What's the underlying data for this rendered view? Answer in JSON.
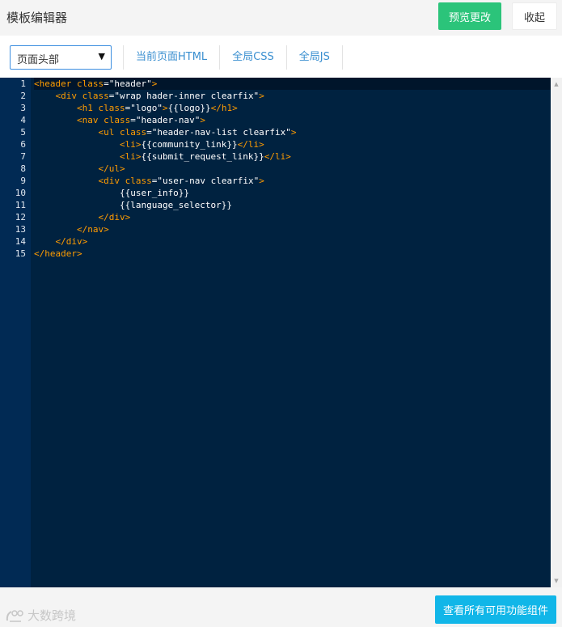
{
  "header": {
    "title": "模板编辑器",
    "preview_label": "预览更改",
    "collapse_label": "收起"
  },
  "toolbar": {
    "select_value": "页面头部",
    "tabs": [
      {
        "label": "当前页面HTML"
      },
      {
        "label": "全局CSS"
      },
      {
        "label": "全局JS"
      }
    ]
  },
  "editor": {
    "line_numbers": [
      "1",
      "2",
      "3",
      "4",
      "5",
      "6",
      "7",
      "8",
      "9",
      "10",
      "11",
      "12",
      "13",
      "14",
      "15"
    ],
    "lines": [
      [
        {
          "t": "tag",
          "v": "<header"
        },
        {
          "t": "text",
          "v": " "
        },
        {
          "t": "attr",
          "v": "class"
        },
        {
          "t": "text",
          "v": "="
        },
        {
          "t": "str",
          "v": "\"header\""
        },
        {
          "t": "tag",
          "v": ">"
        }
      ],
      [
        {
          "t": "text",
          "v": "    "
        },
        {
          "t": "tag",
          "v": "<div"
        },
        {
          "t": "text",
          "v": " "
        },
        {
          "t": "attr",
          "v": "class"
        },
        {
          "t": "text",
          "v": "="
        },
        {
          "t": "str",
          "v": "\"wrap hader-inner clearfix\""
        },
        {
          "t": "tag",
          "v": ">"
        }
      ],
      [
        {
          "t": "text",
          "v": "        "
        },
        {
          "t": "tag",
          "v": "<h1"
        },
        {
          "t": "text",
          "v": " "
        },
        {
          "t": "attr",
          "v": "class"
        },
        {
          "t": "text",
          "v": "="
        },
        {
          "t": "str",
          "v": "\"logo\""
        },
        {
          "t": "tag",
          "v": ">"
        },
        {
          "t": "text",
          "v": "{{logo}}"
        },
        {
          "t": "tag",
          "v": "</h1>"
        }
      ],
      [
        {
          "t": "text",
          "v": "        "
        },
        {
          "t": "tag",
          "v": "<nav"
        },
        {
          "t": "text",
          "v": " "
        },
        {
          "t": "attr",
          "v": "class"
        },
        {
          "t": "text",
          "v": "="
        },
        {
          "t": "str",
          "v": "\"header-nav\""
        },
        {
          "t": "tag",
          "v": ">"
        }
      ],
      [
        {
          "t": "text",
          "v": "            "
        },
        {
          "t": "tag",
          "v": "<ul"
        },
        {
          "t": "text",
          "v": " "
        },
        {
          "t": "attr",
          "v": "class"
        },
        {
          "t": "text",
          "v": "="
        },
        {
          "t": "str",
          "v": "\"header-nav-list clearfix\""
        },
        {
          "t": "tag",
          "v": ">"
        }
      ],
      [
        {
          "t": "text",
          "v": "                "
        },
        {
          "t": "tag",
          "v": "<li>"
        },
        {
          "t": "text",
          "v": "{{community_link}}"
        },
        {
          "t": "tag",
          "v": "</li>"
        }
      ],
      [
        {
          "t": "text",
          "v": "                "
        },
        {
          "t": "tag",
          "v": "<li>"
        },
        {
          "t": "text",
          "v": "{{submit_request_link}}"
        },
        {
          "t": "tag",
          "v": "</li>"
        }
      ],
      [
        {
          "t": "text",
          "v": "            "
        },
        {
          "t": "tag",
          "v": "</ul>"
        }
      ],
      [
        {
          "t": "text",
          "v": "            "
        },
        {
          "t": "tag",
          "v": "<div"
        },
        {
          "t": "text",
          "v": " "
        },
        {
          "t": "attr",
          "v": "class"
        },
        {
          "t": "text",
          "v": "="
        },
        {
          "t": "str",
          "v": "\"user-nav clearfix\""
        },
        {
          "t": "tag",
          "v": ">"
        }
      ],
      [
        {
          "t": "text",
          "v": "                {{user_info}}"
        }
      ],
      [
        {
          "t": "text",
          "v": "                {{language_selector}}"
        }
      ],
      [
        {
          "t": "text",
          "v": "            "
        },
        {
          "t": "tag",
          "v": "</div>"
        }
      ],
      [
        {
          "t": "text",
          "v": "        "
        },
        {
          "t": "tag",
          "v": "</nav>"
        }
      ],
      [
        {
          "t": "text",
          "v": "    "
        },
        {
          "t": "tag",
          "v": "</div>"
        }
      ],
      [
        {
          "t": "tag",
          "v": "</header>"
        }
      ]
    ]
  },
  "footer": {
    "widgets_label": "查看所有可用功能组件",
    "watermark_text": "大数跨境"
  },
  "colors": {
    "preview_button": "#2bc47a",
    "widgets_button": "#11b6e8",
    "editor_bg": "#002240",
    "gutter_bg": "#012a54",
    "tag_color": "#ff9d00",
    "tab_link": "#3a8fd0"
  },
  "icons": {
    "select_caret": "caret-down-icon",
    "scroll_up": "scroll-up-arrow-icon",
    "scroll_down": "scroll-down-arrow-icon",
    "watermark_logo": "watermark-logo-icon"
  }
}
